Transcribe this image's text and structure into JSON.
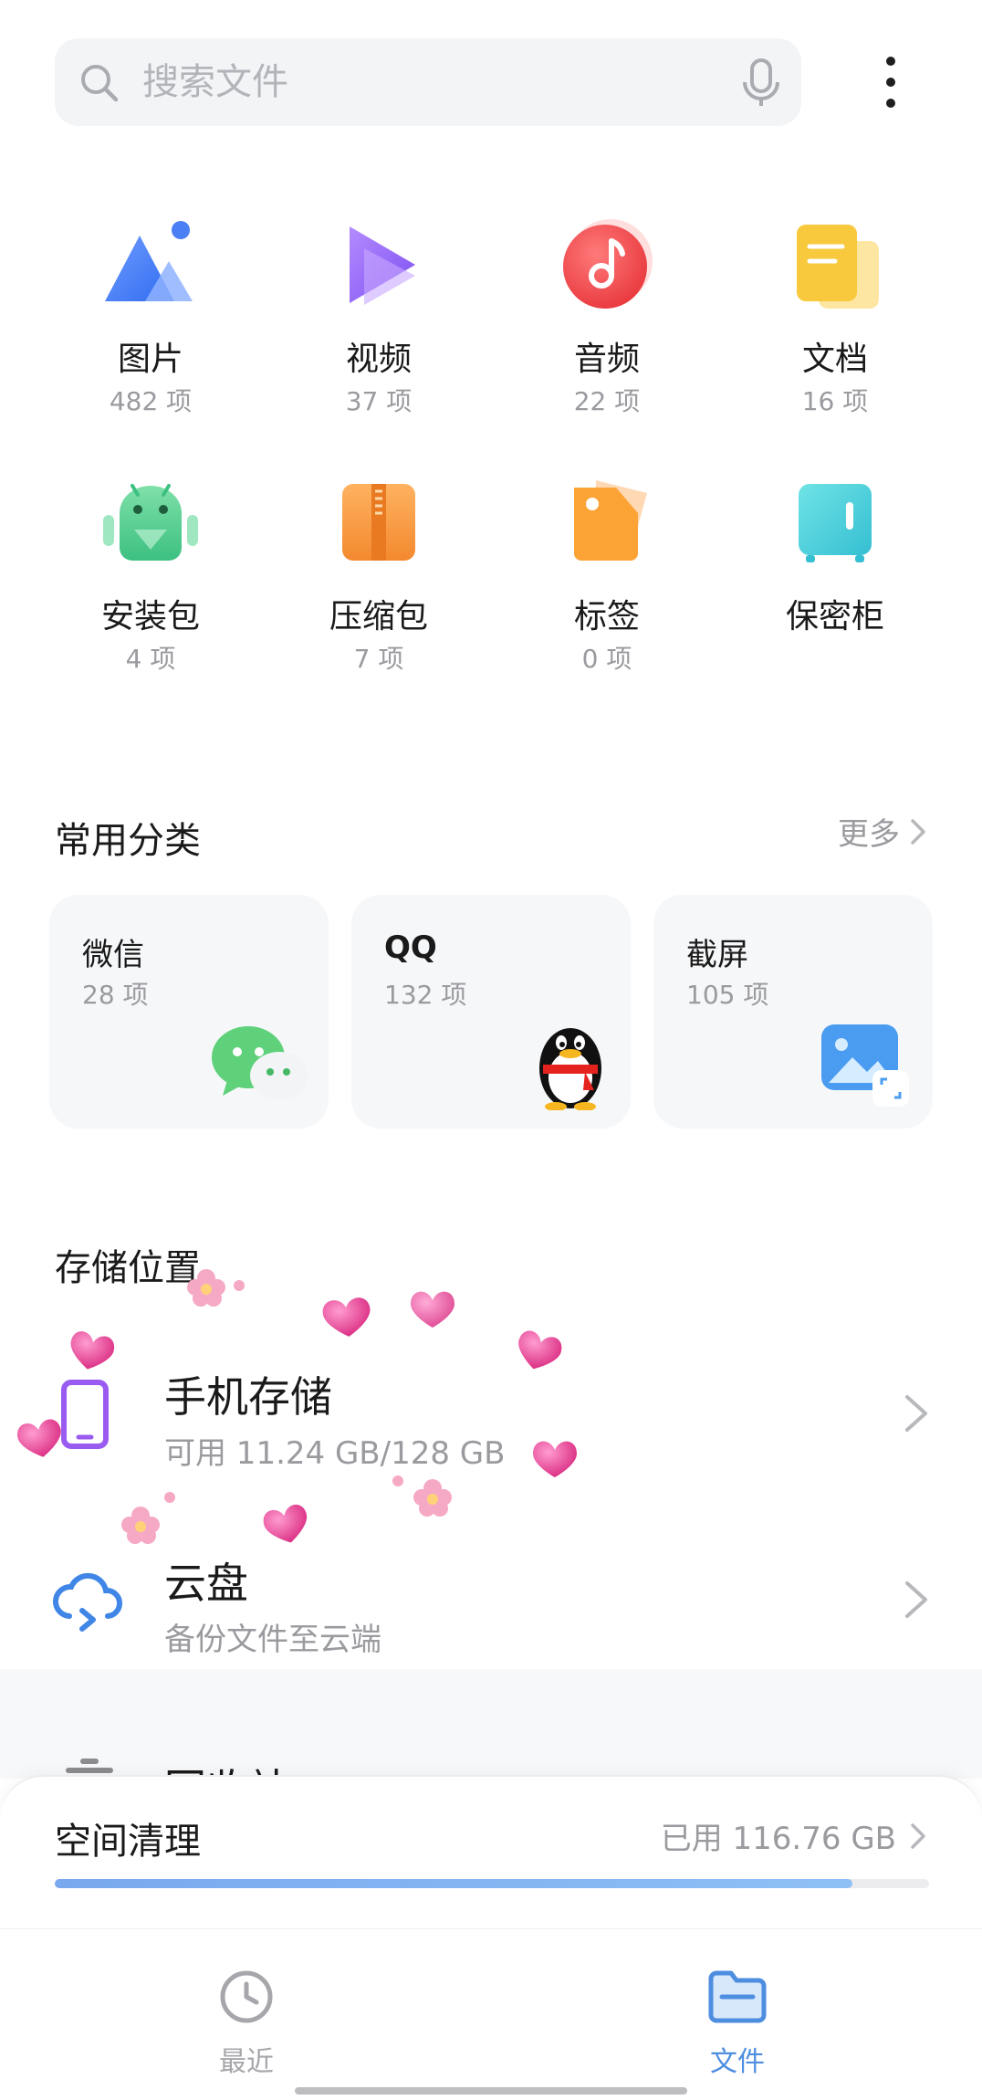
{
  "search": {
    "placeholder": "搜索文件"
  },
  "categories": [
    {
      "name": "图片",
      "count": "482 项"
    },
    {
      "name": "视频",
      "count": "37 项"
    },
    {
      "name": "音频",
      "count": "22 项"
    },
    {
      "name": "文档",
      "count": "16 项"
    },
    {
      "name": "安装包",
      "count": "4 项"
    },
    {
      "name": "压缩包",
      "count": "7 项"
    },
    {
      "name": "标签",
      "count": "0 项"
    },
    {
      "name": "保密柜",
      "count": ""
    }
  ],
  "common": {
    "title": "常用分类",
    "more": "更多",
    "cards": [
      {
        "name": "微信",
        "count": "28 项"
      },
      {
        "name": "QQ",
        "count": "132 项"
      },
      {
        "name": "截屏",
        "count": "105 项"
      }
    ]
  },
  "storage": {
    "title": "存储位置",
    "items": [
      {
        "name": "手机存储",
        "sub": "可用 11.24 GB/128 GB"
      },
      {
        "name": "云盘",
        "sub": "备份文件至云端"
      }
    ],
    "partial_item": "回收站"
  },
  "cleanup": {
    "title": "空间清理",
    "used": "已用 116.76 GB",
    "progress_fraction": 0.912
  },
  "nav": {
    "tabs": [
      {
        "label": "最近",
        "active": false
      },
      {
        "label": "文件",
        "active": true
      }
    ]
  },
  "colors": {
    "accent": "#4d8ee0",
    "muted": "#9a9a9f",
    "inactive_nav": "#a6a6ab"
  }
}
